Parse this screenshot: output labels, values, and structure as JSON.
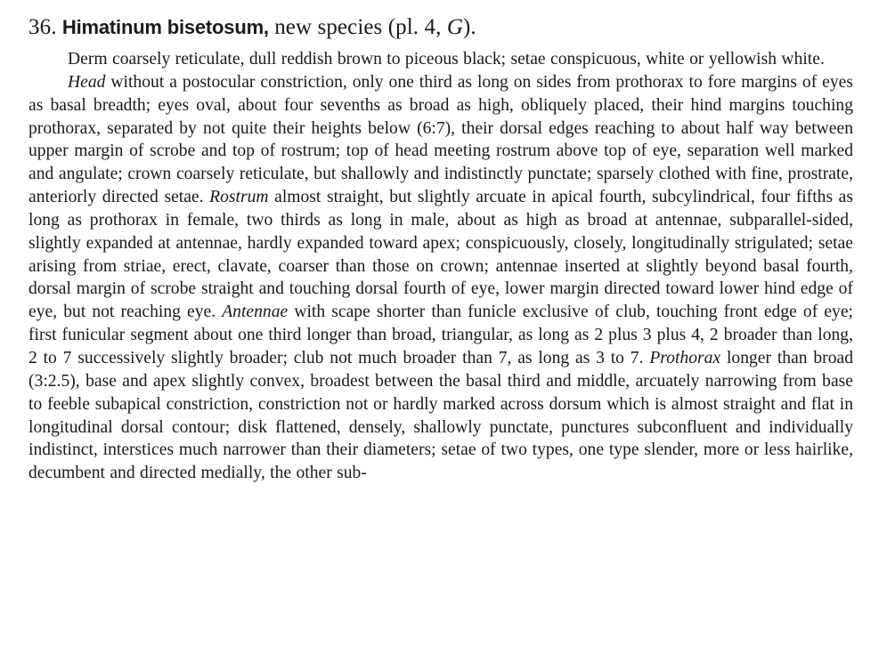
{
  "heading": {
    "number": "36.",
    "species": "Himatinum bisetosum,",
    "rest_before": " new species (pl. 4, ",
    "plate_letter": "G",
    "rest_after": ")."
  },
  "paragraph_1": "Derm coarsely reticulate, dull reddish brown to piceous black; setae conspicuous, white or yellowish white.",
  "paragraph_2": {
    "head_label": "Head",
    "head_text": " without a postocular constriction, only one third as long on sides from prothorax to fore margins of eyes as basal breadth; eyes oval, about four sevenths as broad as high, obliquely placed, their hind margins touching prothorax, separated by not quite their heights below (6:7), their dorsal edges reaching to about half way between upper margin of scrobe and top of rostrum; top of head meeting rostrum above top of eye, separation well marked and angulate; crown coarsely reticulate, but shallowly and indistinctly punctate; sparsely clothed with fine, prostrate, anteriorly directed setae. ",
    "rostrum_label": "Rostrum",
    "rostrum_text": " almost straight, but slightly arcuate in apical fourth, subcylindrical, four fifths as long as prothorax in female, two thirds as long in male, about as high as broad at antennae, subparallel-sided, slightly expanded at antennae, hardly expanded toward apex; conspicuously, closely, longitudinally strigulated; setae arising from striae, erect, clavate, coarser than those on crown; antennae inserted at slightly beyond basal fourth, dorsal margin of scrobe straight and touching dorsal fourth of eye, lower margin directed toward lower hind edge of eye, but not reaching eye. ",
    "antennae_label": "Antennae",
    "antennae_text": " with scape shorter than funicle exclusive of club, touching front edge of eye; first funicular segment about one third longer than broad, triangular, as long as 2 plus 3 plus 4, 2 broader than long, 2 to 7 successively slightly broader; club not much broader than 7, as long as 3 to 7. ",
    "prothorax_label": "Prothorax",
    "prothorax_text": " longer than broad (3:2.5), base and apex slightly convex, broadest between the basal third and middle, arcuately narrowing from base to feeble subapical constriction, constriction not or hardly marked across dorsum which is almost straight and flat in longitudinal dorsal contour; disk flattened, densely, shallowly punctate, punctures subconfluent and individually indistinct, interstices much narrower than their diameters; setae of two types, one type slender, more or less hairlike, decumbent and directed medially, the other sub-"
  }
}
